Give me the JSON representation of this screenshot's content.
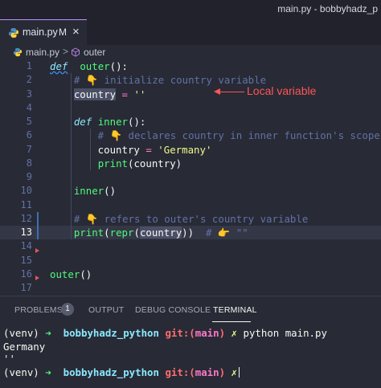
{
  "window": {
    "title": "main.py - bobbyhadz_p"
  },
  "tab": {
    "filename": "main.py",
    "modified": "M",
    "close": "×",
    "icon": "python-icon"
  },
  "breadcrumb": {
    "file": "main.py",
    "separator": ">",
    "symbol": "outer",
    "symbol_icon": "function-cube-icon"
  },
  "editor": {
    "current_line": 13,
    "lines": [
      {
        "n": "1",
        "segs": [
          [
            "kw",
            "def"
          ],
          [
            "",
            "  "
          ],
          [
            "fn",
            "outer"
          ],
          [
            "",
            "():"
          ]
        ]
      },
      {
        "n": "2",
        "segs": [
          [
            "cm",
            "    # 👇 initialize country variable"
          ]
        ]
      },
      {
        "n": "3",
        "segs": [
          [
            "",
            "    "
          ],
          [
            "var",
            "country"
          ],
          [
            "op",
            " ="
          ],
          [
            "str",
            " ''"
          ]
        ]
      },
      {
        "n": "4",
        "segs": []
      },
      {
        "n": "5",
        "segs": [
          [
            "",
            "    "
          ],
          [
            "kw",
            "def"
          ],
          [
            "",
            " "
          ],
          [
            "fn",
            "inner"
          ],
          [
            "",
            "():"
          ]
        ]
      },
      {
        "n": "6",
        "segs": [
          [
            "cm",
            "        # 👇 declares country in inner function's scope"
          ]
        ]
      },
      {
        "n": "7",
        "segs": [
          [
            "",
            "        country "
          ],
          [
            "op",
            "="
          ],
          [
            "str",
            " 'Germany'"
          ]
        ]
      },
      {
        "n": "8",
        "segs": [
          [
            "",
            "        "
          ],
          [
            "fn",
            "print"
          ],
          [
            "",
            "(country)"
          ]
        ]
      },
      {
        "n": "9",
        "segs": []
      },
      {
        "n": "10",
        "segs": [
          [
            "",
            "    "
          ],
          [
            "fn",
            "inner"
          ],
          [
            "",
            "()"
          ]
        ]
      },
      {
        "n": "11",
        "segs": []
      },
      {
        "n": "12",
        "segs": [
          [
            "cm",
            "    # 👇 refers to outer's country variable"
          ]
        ]
      },
      {
        "n": "13",
        "segs": [
          [
            "",
            "    "
          ],
          [
            "fn",
            "print"
          ],
          [
            "",
            "("
          ],
          [
            "fn",
            "repr"
          ],
          [
            "",
            "("
          ],
          [
            "var",
            "country"
          ],
          [
            "",
            "))"
          ],
          [
            "cm",
            "  # 👉 \"\""
          ]
        ]
      },
      {
        "n": "14",
        "segs": []
      },
      {
        "n": "15",
        "segs": []
      },
      {
        "n": "16",
        "segs": [
          [
            "fn",
            "outer"
          ],
          [
            "",
            "()"
          ]
        ]
      },
      {
        "n": "17",
        "segs": []
      }
    ],
    "annotation": "Local variable"
  },
  "panel": {
    "tabs": [
      "PROBLEMS",
      "OUTPUT",
      "DEBUG CONSOLE",
      "TERMINAL"
    ],
    "problems_count": "1",
    "active_tab": "TERMINAL"
  },
  "terminal": {
    "line1": {
      "venv": "(venv)",
      "arrow": "➜",
      "dir": "bobbyhadz_python",
      "git": "git:(",
      "branch": "main",
      "git_close": ")",
      "x": "✗",
      "cmd": "python main.py"
    },
    "line2": "Germany",
    "line3": "''",
    "line4": {
      "venv": "(venv)",
      "arrow": "➜",
      "dir": "bobbyhadz_python",
      "git": "git:(",
      "branch": "main",
      "git_close": ")",
      "x": "✗"
    }
  },
  "colors": {
    "background": "#282a36",
    "keyword": "#8be9fd",
    "function": "#50fa7b",
    "string": "#f1fa8c",
    "operator": "#ff79c6",
    "comment": "#6272a4",
    "annotation": "#ff5555"
  }
}
